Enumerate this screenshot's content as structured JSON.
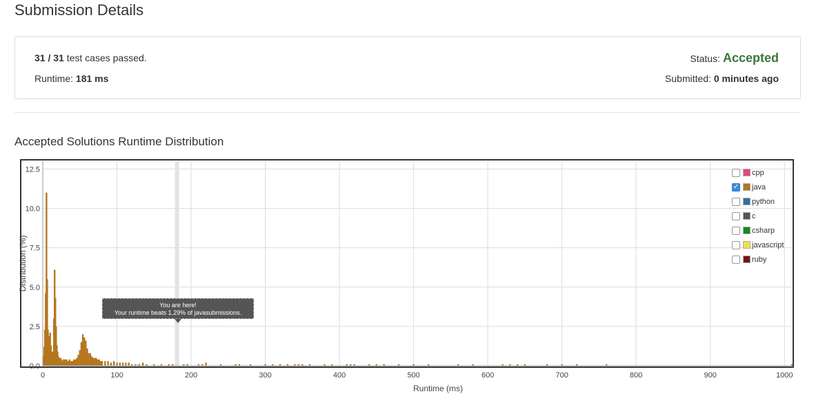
{
  "page": {
    "title": "Submission Details"
  },
  "summary": {
    "passed_count": "31 / 31",
    "passed_suffix": "test cases passed.",
    "runtime_label": "Runtime:",
    "runtime_value": "181 ms",
    "status_label": "Status:",
    "status_value": "Accepted",
    "submitted_label": "Submitted:",
    "submitted_value": "0 minutes ago"
  },
  "section": {
    "title": "Accepted Solutions Runtime Distribution"
  },
  "tooltip": {
    "line1": "You are here!",
    "line2": "Your runtime beats 1.29% of javasubmissions."
  },
  "legend": [
    {
      "label": "cpp",
      "color": "#e8467c",
      "checked": false
    },
    {
      "label": "java",
      "color": "#b5761f",
      "checked": true
    },
    {
      "label": "python",
      "color": "#2f6fa8",
      "checked": false
    },
    {
      "label": "c",
      "color": "#555555",
      "checked": false
    },
    {
      "label": "csharp",
      "color": "#118d1b",
      "checked": false
    },
    {
      "label": "javascript",
      "color": "#f2e14b",
      "checked": false
    },
    {
      "label": "ruby",
      "color": "#7a1212",
      "checked": false
    }
  ],
  "chart_data": {
    "type": "bar",
    "xlabel": "Runtime (ms)",
    "ylabel": "Distribution (%)",
    "xlim": [
      0,
      1010
    ],
    "ylim": [
      0,
      13
    ],
    "xticks": [
      0,
      100,
      200,
      300,
      400,
      500,
      600,
      700,
      800,
      900,
      1000
    ],
    "yticks": [
      "0.0",
      "2.5",
      "5.0",
      "7.5",
      "10.0",
      "12.5"
    ],
    "ytick_values": [
      0,
      2.5,
      5,
      7.5,
      10,
      12.5
    ],
    "highlight_x": 181,
    "bar_color": "#b5761f",
    "series": [
      {
        "name": "java",
        "x": [
          1,
          2,
          3,
          4,
          5,
          6,
          7,
          8,
          9,
          10,
          11,
          12,
          13,
          14,
          15,
          16,
          17,
          18,
          19,
          20,
          21,
          22,
          23,
          24,
          25,
          26,
          27,
          28,
          29,
          30,
          32,
          34,
          36,
          38,
          40,
          42,
          44,
          46,
          48,
          50,
          52,
          54,
          56,
          58,
          60,
          62,
          64,
          66,
          68,
          70,
          72,
          74,
          76,
          78,
          80,
          84,
          88,
          92,
          96,
          100,
          104,
          108,
          112,
          116,
          120,
          125,
          130,
          135,
          140,
          150,
          160,
          170,
          175,
          190,
          195,
          210,
          215,
          220,
          240,
          260,
          265,
          280,
          300,
          310,
          320,
          330,
          340,
          345,
          350,
          360,
          380,
          390,
          410,
          415,
          420,
          440,
          450,
          460,
          480,
          500,
          520,
          560,
          580,
          620,
          630,
          640,
          650,
          680,
          700,
          720,
          760,
          1010
        ],
        "values": [
          0.6,
          1.2,
          2.3,
          4.6,
          11.0,
          5.5,
          2.3,
          1.9,
          1.7,
          2.1,
          1.3,
          0.8,
          0.9,
          0.9,
          3.0,
          6.1,
          4.3,
          2.5,
          1.3,
          0.9,
          0.6,
          0.5,
          0.4,
          0.5,
          0.4,
          0.3,
          0.3,
          0.4,
          0.4,
          0.4,
          0.4,
          0.3,
          0.4,
          0.3,
          0.3,
          0.4,
          0.4,
          0.5,
          0.7,
          1.0,
          1.5,
          2.0,
          1.8,
          1.6,
          1.1,
          0.8,
          0.8,
          0.6,
          0.5,
          0.5,
          0.5,
          0.4,
          0.4,
          0.3,
          0.3,
          0.3,
          0.3,
          0.2,
          0.3,
          0.2,
          0.2,
          0.2,
          0.2,
          0.2,
          0.1,
          0.1,
          0.1,
          0.2,
          0.1,
          0.1,
          0.1,
          0.1,
          0.1,
          0.1,
          0.1,
          0.1,
          0.1,
          0.2,
          0.1,
          0.1,
          0.1,
          0.1,
          0.1,
          0.1,
          0.1,
          0.1,
          0.1,
          0.1,
          0.1,
          0.1,
          0.1,
          0.1,
          0.1,
          0.1,
          0.1,
          0.1,
          0.1,
          0.1,
          0.1,
          0.1,
          0.1,
          0.1,
          0.1,
          0.1,
          0.1,
          0.1,
          0.1,
          0.1,
          0.1,
          0.1,
          0.1,
          0.1
        ]
      }
    ]
  }
}
